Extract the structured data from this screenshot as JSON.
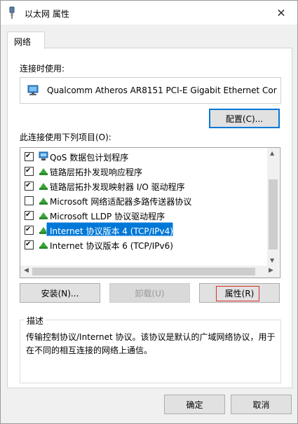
{
  "window": {
    "title": "以太网 属性",
    "close": "✕"
  },
  "tab": {
    "label": "网络"
  },
  "connect_using": {
    "label": "连接时使用:",
    "adapter": "Qualcomm Atheros AR8151 PCI-E Gigabit Ethernet Cor",
    "configure_button": "配置(C)..."
  },
  "items": {
    "label": "此连接使用下列项目(O):",
    "list": [
      {
        "label": "QoS 数据包计划程序",
        "checked": true,
        "icon": "network-service-icon"
      },
      {
        "label": "链路层拓扑发现响应程序",
        "checked": true,
        "icon": "protocol-icon"
      },
      {
        "label": "链路层拓扑发现映射器 I/O 驱动程序",
        "checked": true,
        "icon": "protocol-icon"
      },
      {
        "label": "Microsoft 网络适配器多路传送器协议",
        "checked": false,
        "icon": "protocol-icon"
      },
      {
        "label": "Microsoft LLDP 协议驱动程序",
        "checked": true,
        "icon": "protocol-icon"
      },
      {
        "label": "Internet 协议版本 4 (TCP/IPv4)",
        "checked": true,
        "icon": "protocol-icon",
        "selected": true
      },
      {
        "label": "Internet 协议版本 6 (TCP/IPv6)",
        "checked": true,
        "icon": "protocol-icon"
      }
    ]
  },
  "buttons": {
    "install": "安装(N)...",
    "uninstall": "卸载(U)",
    "properties": "属性(R)",
    "ok": "确定",
    "cancel": "取消"
  },
  "description": {
    "legend": "描述",
    "text": "传输控制协议/Internet 协议。该协议是默认的广域网络协议，用于在不同的相互连接的网络上通信。"
  },
  "colors": {
    "accent": "#0078d7",
    "focus_outline": "#d9312b",
    "panel_bg": "#ffffff",
    "dialog_bg": "#f0f0f0"
  }
}
